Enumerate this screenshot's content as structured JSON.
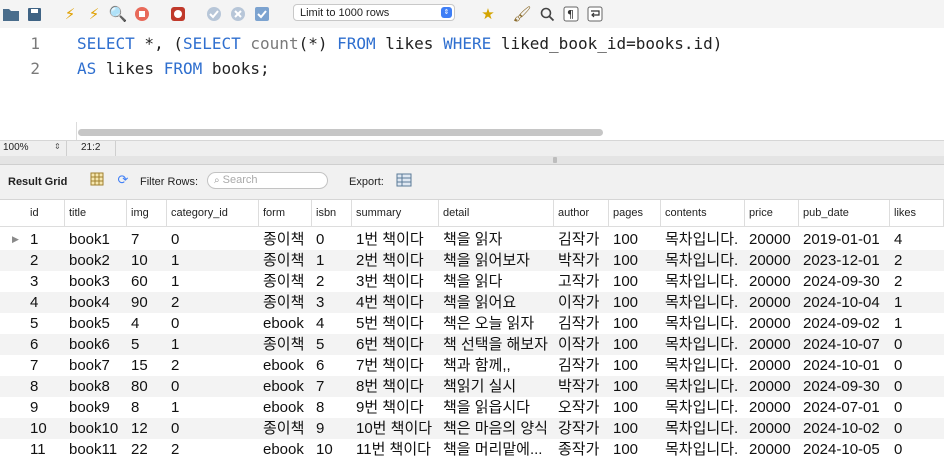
{
  "toolbar": {
    "icons": [
      "open-folder-icon",
      "save-icon",
      "execute-icon",
      "execute-current-icon",
      "explain-icon",
      "stop-icon",
      "toggle-error-icon",
      "commit-icon",
      "rollback-icon",
      "autocommit-icon",
      "star-icon",
      "beautify-icon",
      "find-icon",
      "invisible-chars-icon",
      "wrap-icon"
    ],
    "limit_label": "Limit to 1000 rows"
  },
  "editor": {
    "lines": [
      {
        "num": "1",
        "tokens": [
          {
            "t": "SELECT",
            "c": "kw"
          },
          {
            "t": " *, (",
            "c": ""
          },
          {
            "t": "SELECT",
            "c": "kw"
          },
          {
            "t": " ",
            "c": ""
          },
          {
            "t": "count",
            "c": "fn"
          },
          {
            "t": "(*) ",
            "c": ""
          },
          {
            "t": "FROM",
            "c": "kw"
          },
          {
            "t": " likes ",
            "c": ""
          },
          {
            "t": "WHERE",
            "c": "kw"
          },
          {
            "t": " liked_book_id=books.id)",
            "c": ""
          }
        ]
      },
      {
        "num": "2",
        "tokens": [
          {
            "t": "AS",
            "c": "kw"
          },
          {
            "t": " likes ",
            "c": ""
          },
          {
            "t": "FROM",
            "c": "kw"
          },
          {
            "t": " books;",
            "c": ""
          }
        ]
      }
    ]
  },
  "status": {
    "zoom": "100%",
    "cursor_pos": "21:2"
  },
  "result": {
    "grid_label": "Result Grid",
    "filter_label": "Filter Rows:",
    "search_placeholder": "Search",
    "export_label": "Export:"
  },
  "table": {
    "columns": [
      "id",
      "title",
      "img",
      "category_id",
      "form",
      "isbn",
      "summary",
      "detail",
      "author",
      "pages",
      "contents",
      "price",
      "pub_date",
      "likes"
    ],
    "rows": [
      [
        "1",
        "book1",
        "7",
        "0",
        "종이책",
        "0",
        "1번 책이다",
        "책을 읽자",
        "김작가",
        "100",
        "목차입니다.",
        "20000",
        "2019-01-01",
        "4"
      ],
      [
        "2",
        "book2",
        "10",
        "1",
        "종이책",
        "1",
        "2번 책이다",
        "책을 읽어보자",
        "박작가",
        "100",
        "목차입니다.",
        "20000",
        "2023-12-01",
        "2"
      ],
      [
        "3",
        "book3",
        "60",
        "1",
        "종이책",
        "2",
        "3번 책이다",
        "책을 읽다",
        "고작가",
        "100",
        "목차입니다.",
        "20000",
        "2024-09-30",
        "2"
      ],
      [
        "4",
        "book4",
        "90",
        "2",
        "종이책",
        "3",
        "4번 책이다",
        "책을 읽어요",
        "이작가",
        "100",
        "목차입니다.",
        "20000",
        "2024-10-04",
        "1"
      ],
      [
        "5",
        "book5",
        "4",
        "0",
        "ebook",
        "4",
        "5번 책이다",
        "책은 오늘 읽자",
        "김작가",
        "100",
        "목차입니다.",
        "20000",
        "2024-09-02",
        "1"
      ],
      [
        "6",
        "book6",
        "5",
        "1",
        "종이책",
        "5",
        "6번 책이다",
        "책 선택을 해보자",
        "이작가",
        "100",
        "목차입니다.",
        "20000",
        "2024-10-07",
        "0"
      ],
      [
        "7",
        "book7",
        "15",
        "2",
        "ebook",
        "6",
        "7번 책이다",
        "책과 함께,,",
        "김작가",
        "100",
        "목차입니다.",
        "20000",
        "2024-10-01",
        "0"
      ],
      [
        "8",
        "book8",
        "80",
        "0",
        "ebook",
        "7",
        "8번 책이다",
        "책읽기 실시",
        "박작가",
        "100",
        "목차입니다.",
        "20000",
        "2024-09-30",
        "0"
      ],
      [
        "9",
        "book9",
        "8",
        "1",
        "ebook",
        "8",
        "9번 책이다",
        "책을 읽읍시다",
        "오작가",
        "100",
        "목차입니다.",
        "20000",
        "2024-07-01",
        "0"
      ],
      [
        "10",
        "book10",
        "12",
        "0",
        "종이책",
        "9",
        "10번 책이다",
        "책은 마음의 양식",
        "강작가",
        "100",
        "목차입니다.",
        "20000",
        "2024-10-02",
        "0"
      ],
      [
        "11",
        "book11",
        "22",
        "2",
        "ebook",
        "10",
        "11번 책이다",
        "책을 머리맡에...",
        "종작가",
        "100",
        "목차입니다.",
        "20000",
        "2024-10-05",
        "0"
      ]
    ]
  },
  "colors": {
    "keyword": "#2f6fcf",
    "function": "#7a7a7a",
    "accent": "#3e7ef6"
  }
}
